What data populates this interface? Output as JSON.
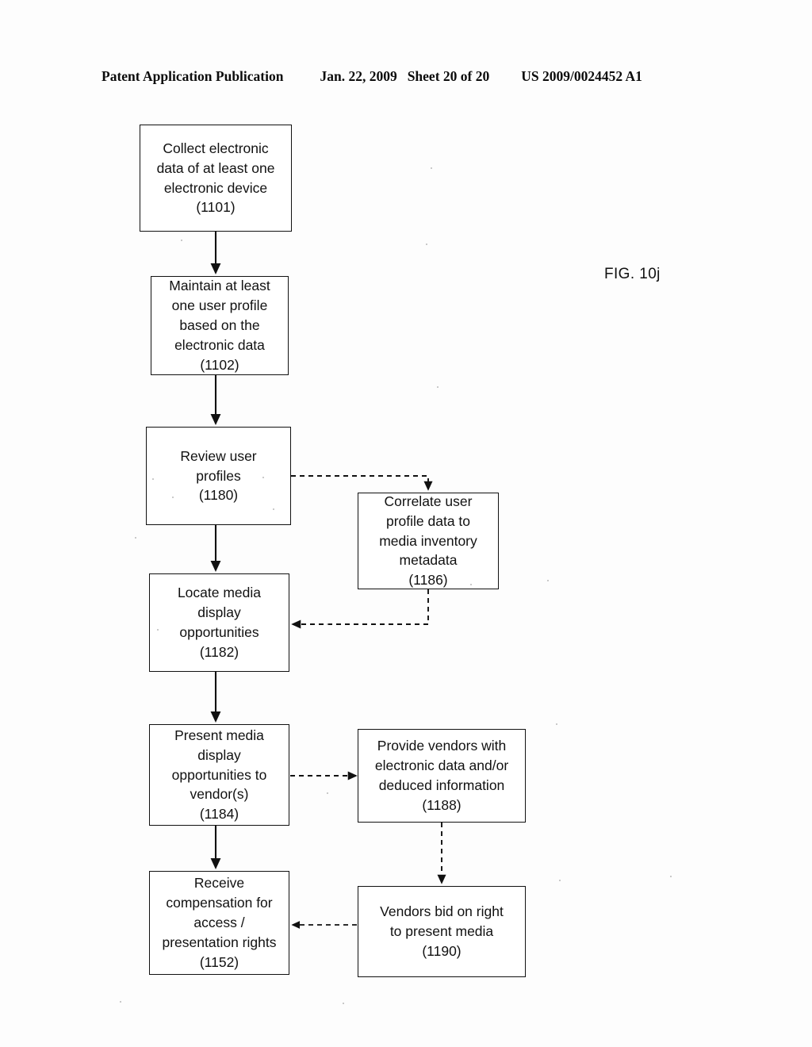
{
  "header": {
    "publication": "Patent Application Publication",
    "date": "Jan. 22, 2009",
    "sheet": "Sheet 20 of 20",
    "number": "US 2009/0024452 A1"
  },
  "figure": {
    "label": "FIG. 10j"
  },
  "flowchart": {
    "type": "flowchart",
    "boxes": [
      {
        "id": "1101",
        "ref": "(1101)",
        "lines": [
          "Collect electronic",
          "data of at least one",
          "electronic device",
          "(1101)"
        ]
      },
      {
        "id": "1102",
        "ref": "(1102)",
        "lines": [
          "Maintain at least",
          "one user profile",
          "based on the",
          "electronic data",
          "(1102)"
        ]
      },
      {
        "id": "1180",
        "ref": "(1180)",
        "lines": [
          "Review user",
          "profiles",
          "(1180)"
        ]
      },
      {
        "id": "1186",
        "ref": "(1186)",
        "lines": [
          "Correlate user",
          "profile data to",
          "media inventory",
          "metadata",
          "(1186)"
        ]
      },
      {
        "id": "1182",
        "ref": "(1182)",
        "lines": [
          "Locate media",
          "display",
          "opportunities",
          "(1182)"
        ]
      },
      {
        "id": "1184",
        "ref": "(1184)",
        "lines": [
          "Present media",
          "display",
          "opportunities to",
          "vendor(s)",
          "(1184)"
        ]
      },
      {
        "id": "1188",
        "ref": "(1188)",
        "lines": [
          "Provide vendors with",
          "electronic data and/or",
          "deduced information",
          "(1188)"
        ]
      },
      {
        "id": "1152",
        "ref": "(1152)",
        "lines": [
          "Receive",
          "compensation for",
          "access /",
          "presentation rights",
          "(1152)"
        ]
      },
      {
        "id": "1190",
        "ref": "(1190)",
        "lines": [
          "Vendors bid on right",
          "to present media",
          "(1190)"
        ]
      }
    ],
    "connectors": [
      {
        "from": "1101",
        "to": "1102",
        "style": "solid",
        "shape": "vertical"
      },
      {
        "from": "1102",
        "to": "1180",
        "style": "solid",
        "shape": "vertical"
      },
      {
        "from": "1180",
        "to": "1186",
        "style": "dashed",
        "shape": "right-then-down"
      },
      {
        "from": "1180",
        "to": "1182",
        "style": "solid",
        "shape": "vertical"
      },
      {
        "from": "1186",
        "to": "1182",
        "style": "dashed",
        "shape": "down-then-left"
      },
      {
        "from": "1182",
        "to": "1184",
        "style": "solid",
        "shape": "vertical"
      },
      {
        "from": "1184",
        "to": "1188",
        "style": "dashed",
        "shape": "horizontal-right"
      },
      {
        "from": "1184",
        "to": "1152",
        "style": "solid",
        "shape": "vertical"
      },
      {
        "from": "1188",
        "to": "1190",
        "style": "dashed",
        "shape": "vertical"
      },
      {
        "from": "1190",
        "to": "1152",
        "style": "dashed",
        "shape": "horizontal-left"
      }
    ],
    "colors": {
      "line": "#111111",
      "box_border": "#111111",
      "background": "#ffffff",
      "text": "#111111"
    }
  }
}
